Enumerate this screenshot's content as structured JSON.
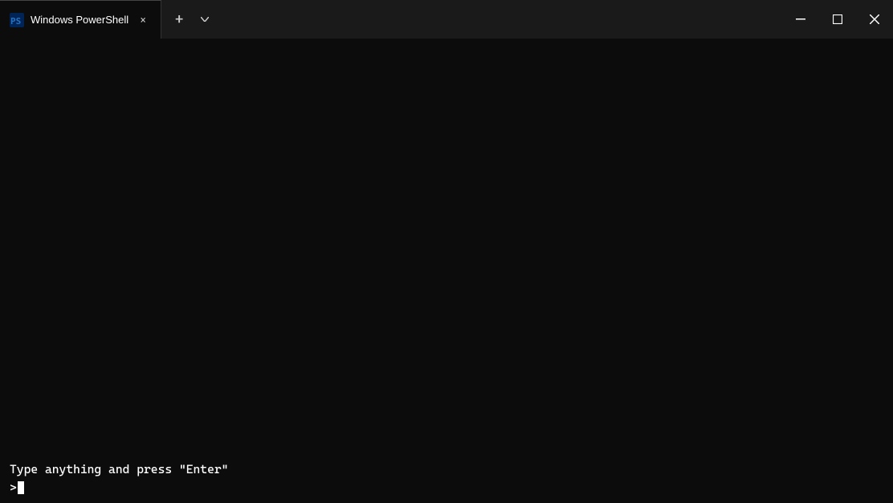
{
  "titlebar": {
    "tab": {
      "label": "Windows PowerShell",
      "close_label": "×"
    },
    "new_tab_label": "+",
    "dropdown_label": "⌄",
    "controls": {
      "minimize": "─",
      "maximize": "□",
      "close": "×"
    }
  },
  "terminal": {
    "instruction_text": "Type anything and press \"Enter\"",
    "prompt": ">"
  }
}
